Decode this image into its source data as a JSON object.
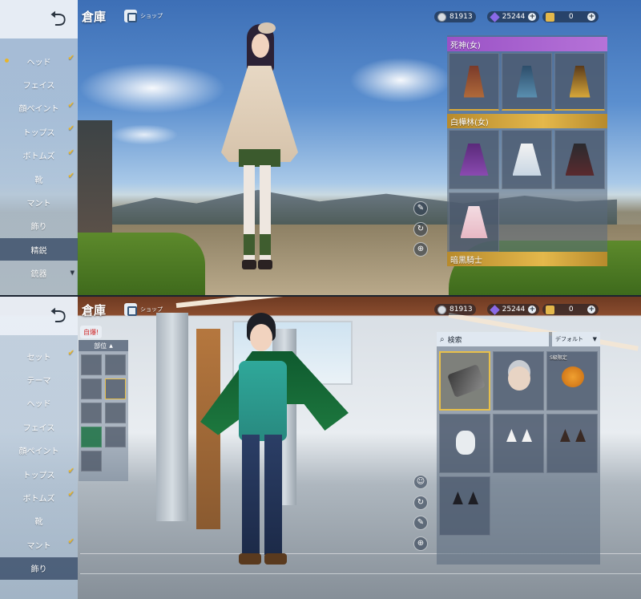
{
  "top_screen": {
    "title": "倉庫",
    "shop_label": "ショップ",
    "currency": {
      "coins": "81913",
      "gems": "25244",
      "tickets": "0"
    },
    "menu_items": [
      {
        "label": "ヘッド",
        "checked": true,
        "dot": true
      },
      {
        "label": "フェイス",
        "checked": false
      },
      {
        "label": "顔ペイント",
        "checked": true
      },
      {
        "label": "トップス",
        "checked": true
      },
      {
        "label": "ボトムズ",
        "checked": true
      },
      {
        "label": "靴",
        "checked": true
      },
      {
        "label": "マント",
        "checked": false
      },
      {
        "label": "飾り",
        "checked": false
      },
      {
        "label": "精鋭",
        "checked": false,
        "active": true
      },
      {
        "label": "銃器",
        "checked": false,
        "dropdown": true
      }
    ],
    "sets": [
      {
        "name": "死神(女)",
        "style": "purple"
      },
      {
        "name": "白樺林(女)",
        "style": "gold"
      },
      {
        "name": "暗黒騎士",
        "style": "gold"
      }
    ]
  },
  "bottom_screen": {
    "title": "倉庫",
    "shop_label": "ショップ",
    "currency": {
      "coins": "81913",
      "gems": "25244",
      "tickets": "0"
    },
    "new_tag": "自爆!",
    "parts_header": "部位",
    "menu_items": [
      {
        "label": "セット",
        "checked": true
      },
      {
        "label": "テーマ",
        "checked": false
      },
      {
        "label": "ヘッド",
        "checked": false
      },
      {
        "label": "フェイス",
        "checked": false
      },
      {
        "label": "顔ペイント",
        "checked": false
      },
      {
        "label": "トップス",
        "checked": true
      },
      {
        "label": "ボトムズ",
        "checked": true
      },
      {
        "label": "靴",
        "checked": false
      },
      {
        "label": "マント",
        "checked": true
      },
      {
        "label": "飾り",
        "checked": false,
        "active": true
      }
    ],
    "search_placeholder": "検索",
    "sort_label": "デフォルト",
    "item_badges": [
      "S級限定"
    ]
  },
  "colors": {
    "accent_gold": "#e8b52a",
    "set_purple": "#9a52c6",
    "set_gold": "#e4b84b"
  }
}
